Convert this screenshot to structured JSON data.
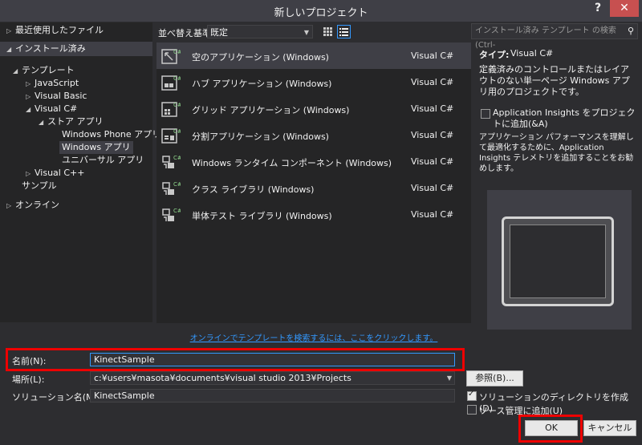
{
  "window": {
    "title": "新しいプロジェクト",
    "help": "?",
    "close": "✕"
  },
  "tree": {
    "recent": "最近使用したファイル",
    "installed": "インストール済み",
    "templates": "テンプレート",
    "javascript": "JavaScript",
    "visualbasic": "Visual Basic",
    "visualcsharp": "Visual C#",
    "storeapps": "ストア アプリ",
    "windowsphone": "Windows Phone アプリ",
    "windowsapps": "Windows アプリ",
    "universal": "ユニバーサル アプリ",
    "visualcpp": "Visual C++",
    "samples": "サンプル",
    "online": "オンライン"
  },
  "toolbar": {
    "sort_label": "並べ替え基準:",
    "sort_value": "既定"
  },
  "templates": [
    {
      "name": "空のアプリケーション (Windows)",
      "lang": "Visual C#"
    },
    {
      "name": "ハブ アプリケーション (Windows)",
      "lang": "Visual C#"
    },
    {
      "name": "グリッド アプリケーション (Windows)",
      "lang": "Visual C#"
    },
    {
      "name": "分割アプリケーション (Windows)",
      "lang": "Visual C#"
    },
    {
      "name": "Windows ランタイム コンポーネント (Windows)",
      "lang": "Visual C#"
    },
    {
      "name": "クラス ライブラリ (Windows)",
      "lang": "Visual C#"
    },
    {
      "name": "単体テスト ライブラリ (Windows)",
      "lang": "Visual C#"
    }
  ],
  "online_link": "オンラインでテンプレートを検索するには、ここをクリックします。",
  "right": {
    "search_placeholder": "インストール済み テンプレート の検索 (Ctrl-",
    "type_label": "タイプ:",
    "type_value": "Visual C#",
    "description": "定義済みのコントロールまたはレイアウトのない単一ページ Windows アプリ用のプロジェクトです。",
    "ai_label": "Application Insights をプロジェクトに追加(&A)",
    "ai_desc": "アプリケーション パフォーマンスを理解して最適化するために、Application Insights テレメトリを追加することをお勧めします。"
  },
  "form": {
    "name_label": "名前(N):",
    "name_value": "KinectSample",
    "location_label": "場所(L):",
    "location_value": "c:¥users¥masota¥documents¥visual studio 2013¥Projects",
    "solution_label": "ソリューション名(M):",
    "solution_value": "KinectSample",
    "browse": "参照(B)...",
    "create_dir": "ソリューションのディレクトリを作成(D)",
    "source_control": "ソース管理に追加(U)",
    "ok": "OK",
    "cancel": "キャンセル"
  },
  "colors": {
    "accent": "#3399ff",
    "highlight": "#e00000",
    "bg": "#2d2d30"
  }
}
